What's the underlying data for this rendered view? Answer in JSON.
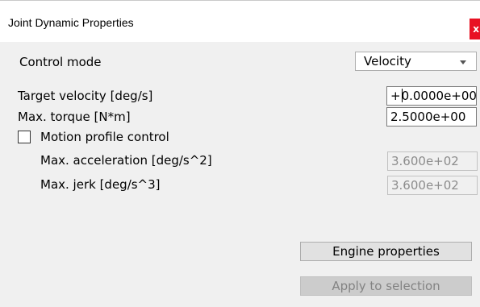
{
  "window": {
    "title": "Joint Dynamic Properties",
    "close_glyph": "x"
  },
  "control_mode": {
    "label": "Control mode",
    "selected": "Velocity"
  },
  "target_velocity": {
    "label": "Target velocity [deg/s]",
    "value_prefix": "+",
    "value_rest": "0.0000e+00"
  },
  "max_torque": {
    "label": "Max. torque [N*m]",
    "value": "2.5000e+00"
  },
  "motion_profile": {
    "label": "Motion profile control",
    "checked": false
  },
  "max_acceleration": {
    "label": "Max. acceleration [deg/s^2]",
    "value": "3.600e+02"
  },
  "max_jerk": {
    "label": "Max. jerk [deg/s^3]",
    "value": "3.600e+02"
  },
  "buttons": {
    "engine_properties": "Engine properties",
    "apply_to_selection": "Apply to selection"
  },
  "colors": {
    "close_button": "#e81123",
    "dialog_background": "#f0f0f0"
  }
}
